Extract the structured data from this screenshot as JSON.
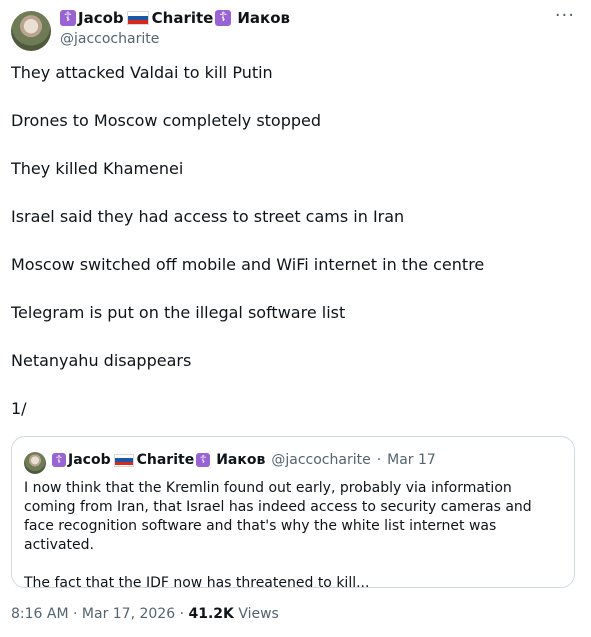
{
  "author": {
    "name_first": "Jacob",
    "name_second": "Charite",
    "name_third": "Иаков",
    "cross_glyph": "☦",
    "handle": "@jaccocharite"
  },
  "menu_icon": "more-icon",
  "more_glyph": "···",
  "tweet": {
    "lines": [
      "They attacked Valdai to kill Putin",
      "Drones to Moscow completely stopped",
      "They killed Khamenei",
      "Israel said they had access to street cams in Iran",
      "Moscow switched off mobile and WiFi internet in the centre",
      "Telegram is put on the illegal software list",
      "Netanyahu disappears",
      "1/"
    ]
  },
  "quote": {
    "name_first": "Jacob",
    "name_second": "Charite",
    "name_third": "Иаков",
    "handle": "@jaccocharite",
    "separator": "·",
    "date": "Mar 17",
    "paragraph1": "I now think that the Kremlin found out early, probably via information coming from Iran, that Israel has indeed access to security cameras and face recognition software and that's why the white list internet was activated.",
    "paragraph2": "The fact that the IDF now has threatened to kill..."
  },
  "footer": {
    "time": "8:16 AM",
    "separator1": " · ",
    "date": "Mar 17, 2026",
    "separator2": " · ",
    "views_count": "41.2K",
    "views_label": " Views"
  },
  "colors": {
    "cross_badge": "#9a63d4",
    "secondary_text": "#536471",
    "border": "#cfd9de",
    "flag": [
      "#ffffff",
      "#1c57a5",
      "#d52b1e"
    ]
  }
}
